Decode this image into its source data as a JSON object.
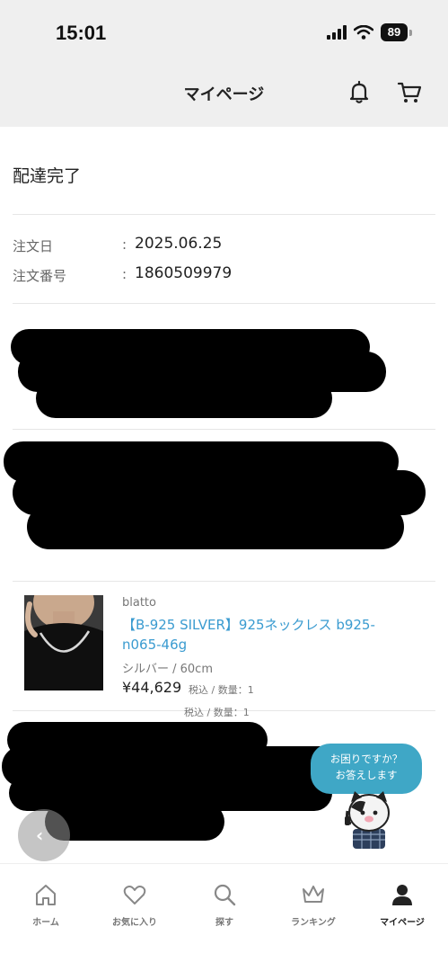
{
  "status_bar": {
    "time": "15:01",
    "battery": "89"
  },
  "header": {
    "title": "マイページ",
    "bell_icon": "bell-icon",
    "cart_icon": "cart-icon"
  },
  "order": {
    "status": "配達完了",
    "date_label": "注文日",
    "date_value": "2025.06.25",
    "number_label": "注文番号",
    "number_value": "1860509979",
    "colon": ":"
  },
  "item": {
    "brand": "blatto",
    "name": "【B-925 SILVER】925ネックレス b925-n065-46g",
    "variant": "シルバー / 60cm",
    "price": "¥44,629",
    "price_note": "税込 / 数量：1"
  },
  "partial_item": {
    "qty_note": "税込 / 数量：1"
  },
  "help": {
    "line1": "お困りですか？",
    "line2": "お答えします"
  },
  "nav": {
    "items": [
      {
        "label": "ホーム",
        "icon": "home-icon"
      },
      {
        "label": "お気に入り",
        "icon": "heart-icon"
      },
      {
        "label": "探す",
        "icon": "search-icon"
      },
      {
        "label": "ランキング",
        "icon": "crown-icon"
      },
      {
        "label": "マイページ",
        "icon": "person-icon"
      }
    ],
    "active": "マイページ"
  },
  "colors": {
    "accent_link": "#3a9bd0",
    "help_bubble": "#3fa7c6",
    "header_bg": "#efefef"
  }
}
